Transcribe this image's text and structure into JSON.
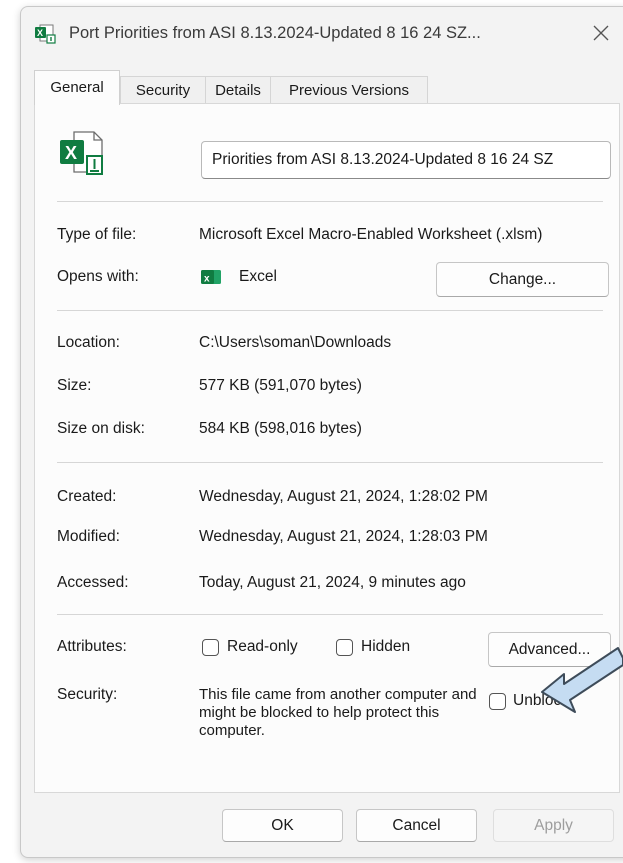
{
  "window": {
    "title": "Port Priorities from ASI  8.13.2024-Updated 8 16 24 SZ..."
  },
  "tabs": [
    {
      "label": "General"
    },
    {
      "label": "Security"
    },
    {
      "label": "Details"
    },
    {
      "label": "Previous Versions"
    }
  ],
  "file": {
    "name": "Priorities from ASI  8.13.2024-Updated 8 16 24 SZ",
    "type_label": "Type of file:",
    "type_value": "Microsoft Excel Macro-Enabled Worksheet (.xlsm)",
    "opens_label": "Opens with:",
    "opens_value": "Excel",
    "change_button": "Change..."
  },
  "location": {
    "location_label": "Location:",
    "location_value": "C:\\Users\\soman\\Downloads",
    "size_label": "Size:",
    "size_value": "577 KB (591,070 bytes)",
    "disk_label": "Size on disk:",
    "disk_value": "584 KB (598,016 bytes)"
  },
  "dates": {
    "created_label": "Created:",
    "created_value": "Wednesday, August 21, 2024, 1:28:02 PM",
    "modified_label": "Modified:",
    "modified_value": "Wednesday, August 21, 2024, 1:28:03 PM",
    "accessed_label": "Accessed:",
    "accessed_value": "Today, August 21, 2024, 9 minutes ago"
  },
  "attributes": {
    "label": "Attributes:",
    "readonly": "Read-only",
    "readonly_checked": false,
    "hidden": "Hidden",
    "hidden_checked": false,
    "advanced_button": "Advanced..."
  },
  "security": {
    "label": "Security:",
    "text": "This file came from another computer and might be blocked to help protect this computer.",
    "unblock": "Unblock",
    "unblock_checked": false
  },
  "footer": {
    "ok": "OK",
    "cancel": "Cancel",
    "apply": "Apply"
  },
  "colors": {
    "excel_green": "#107c41",
    "arrow_fill": "#c5dcf2",
    "arrow_stroke": "#3e4c5a"
  },
  "icons": [
    "excel-file-icon",
    "close-icon",
    "excel-app-icon",
    "pointer-arrow"
  ]
}
